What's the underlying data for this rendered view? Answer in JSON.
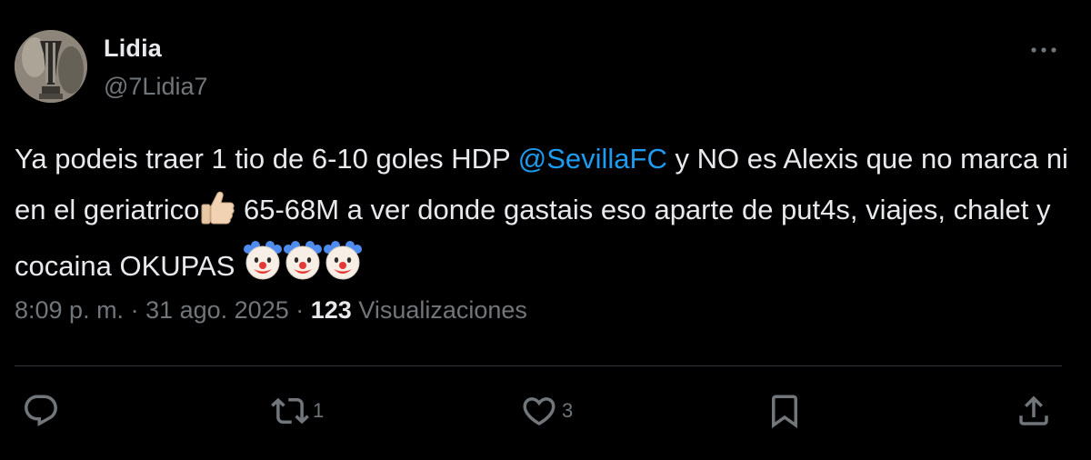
{
  "user": {
    "display_name": "Lidia",
    "handle": "@7Lidia7"
  },
  "tweet": {
    "text_part1": "Ya podeis traer 1 tio de 6-10 goles HDP ",
    "mention": "@SevillaFC",
    "text_part2": " y NO es Alexis que no marca ni en el geriatrico",
    "text_part3": " 65-68M a ver donde gastais eso aparte de put4s, viajes, chalet y cocaina OKUPAS ",
    "emojis": [
      "thumbs-up-emoji",
      "clown-face-emoji",
      "clown-face-emoji",
      "clown-face-emoji"
    ]
  },
  "meta": {
    "time": "8:09 p. m.",
    "separator": " · ",
    "date": "31 ago. 2025",
    "views_count": "123",
    "views_label": " Visualizaciones"
  },
  "actions": {
    "reply_count": "",
    "retweet_count": "1",
    "like_count": "3",
    "bookmark_count": "",
    "share_count": ""
  },
  "icons": [
    "more-icon",
    "reply-icon",
    "retweet-icon",
    "like-icon",
    "bookmark-icon",
    "share-icon"
  ],
  "colors": {
    "background": "#000000",
    "text": "#e7e9ea",
    "secondary": "#71767b",
    "mention": "#1d9bf0",
    "divider": "#2f3336"
  }
}
